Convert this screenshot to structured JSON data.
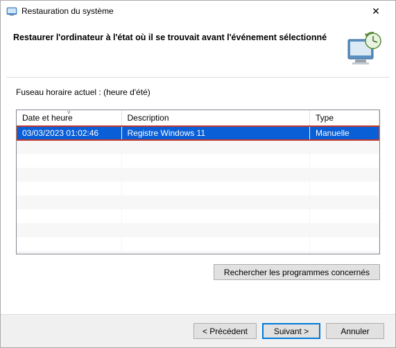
{
  "window": {
    "title": "Restauration du système"
  },
  "header": {
    "heading": "Restaurer l'ordinateur à l'état où il se trouvait avant l'événement sélectionné"
  },
  "timezone_label": "Fuseau horaire actuel : (heure d'été)",
  "table": {
    "columns": {
      "datetime": "Date et heure",
      "description": "Description",
      "type": "Type"
    },
    "rows": [
      {
        "datetime": "03/03/2023 01:02:46",
        "description": "Registre Windows 11",
        "type": "Manuelle",
        "selected": true
      }
    ]
  },
  "buttons": {
    "scan_affected": "Rechercher les programmes concernés",
    "back": "< Précédent",
    "next": "Suivant >",
    "cancel": "Annuler"
  }
}
